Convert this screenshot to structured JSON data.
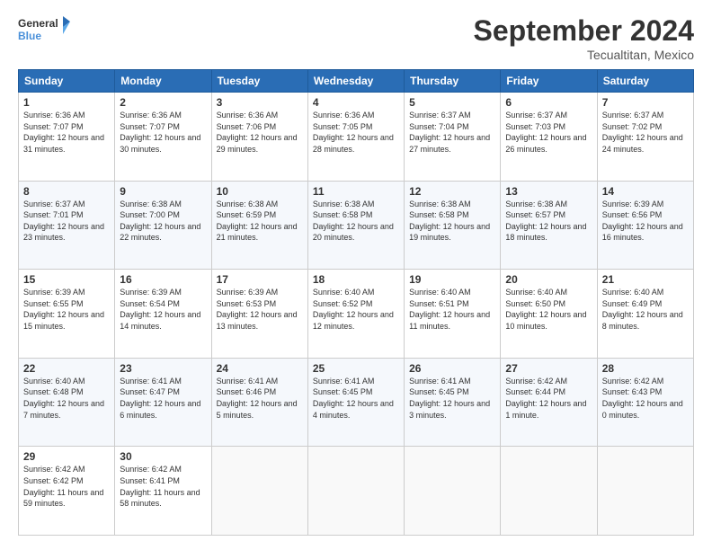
{
  "logo": {
    "line1": "General",
    "line2": "Blue"
  },
  "title": "September 2024",
  "location": "Tecualtitan, Mexico",
  "headers": [
    "Sunday",
    "Monday",
    "Tuesday",
    "Wednesday",
    "Thursday",
    "Friday",
    "Saturday"
  ],
  "weeks": [
    [
      {
        "day": "1",
        "sunrise": "6:36 AM",
        "sunset": "7:07 PM",
        "daylight": "12 hours and 31 minutes."
      },
      {
        "day": "2",
        "sunrise": "6:36 AM",
        "sunset": "7:07 PM",
        "daylight": "12 hours and 30 minutes."
      },
      {
        "day": "3",
        "sunrise": "6:36 AM",
        "sunset": "7:06 PM",
        "daylight": "12 hours and 29 minutes."
      },
      {
        "day": "4",
        "sunrise": "6:36 AM",
        "sunset": "7:05 PM",
        "daylight": "12 hours and 28 minutes."
      },
      {
        "day": "5",
        "sunrise": "6:37 AM",
        "sunset": "7:04 PM",
        "daylight": "12 hours and 27 minutes."
      },
      {
        "day": "6",
        "sunrise": "6:37 AM",
        "sunset": "7:03 PM",
        "daylight": "12 hours and 26 minutes."
      },
      {
        "day": "7",
        "sunrise": "6:37 AM",
        "sunset": "7:02 PM",
        "daylight": "12 hours and 24 minutes."
      }
    ],
    [
      {
        "day": "8",
        "sunrise": "6:37 AM",
        "sunset": "7:01 PM",
        "daylight": "12 hours and 23 minutes."
      },
      {
        "day": "9",
        "sunrise": "6:38 AM",
        "sunset": "7:00 PM",
        "daylight": "12 hours and 22 minutes."
      },
      {
        "day": "10",
        "sunrise": "6:38 AM",
        "sunset": "6:59 PM",
        "daylight": "12 hours and 21 minutes."
      },
      {
        "day": "11",
        "sunrise": "6:38 AM",
        "sunset": "6:58 PM",
        "daylight": "12 hours and 20 minutes."
      },
      {
        "day": "12",
        "sunrise": "6:38 AM",
        "sunset": "6:58 PM",
        "daylight": "12 hours and 19 minutes."
      },
      {
        "day": "13",
        "sunrise": "6:38 AM",
        "sunset": "6:57 PM",
        "daylight": "12 hours and 18 minutes."
      },
      {
        "day": "14",
        "sunrise": "6:39 AM",
        "sunset": "6:56 PM",
        "daylight": "12 hours and 16 minutes."
      }
    ],
    [
      {
        "day": "15",
        "sunrise": "6:39 AM",
        "sunset": "6:55 PM",
        "daylight": "12 hours and 15 minutes."
      },
      {
        "day": "16",
        "sunrise": "6:39 AM",
        "sunset": "6:54 PM",
        "daylight": "12 hours and 14 minutes."
      },
      {
        "day": "17",
        "sunrise": "6:39 AM",
        "sunset": "6:53 PM",
        "daylight": "12 hours and 13 minutes."
      },
      {
        "day": "18",
        "sunrise": "6:40 AM",
        "sunset": "6:52 PM",
        "daylight": "12 hours and 12 minutes."
      },
      {
        "day": "19",
        "sunrise": "6:40 AM",
        "sunset": "6:51 PM",
        "daylight": "12 hours and 11 minutes."
      },
      {
        "day": "20",
        "sunrise": "6:40 AM",
        "sunset": "6:50 PM",
        "daylight": "12 hours and 10 minutes."
      },
      {
        "day": "21",
        "sunrise": "6:40 AM",
        "sunset": "6:49 PM",
        "daylight": "12 hours and 8 minutes."
      }
    ],
    [
      {
        "day": "22",
        "sunrise": "6:40 AM",
        "sunset": "6:48 PM",
        "daylight": "12 hours and 7 minutes."
      },
      {
        "day": "23",
        "sunrise": "6:41 AM",
        "sunset": "6:47 PM",
        "daylight": "12 hours and 6 minutes."
      },
      {
        "day": "24",
        "sunrise": "6:41 AM",
        "sunset": "6:46 PM",
        "daylight": "12 hours and 5 minutes."
      },
      {
        "day": "25",
        "sunrise": "6:41 AM",
        "sunset": "6:45 PM",
        "daylight": "12 hours and 4 minutes."
      },
      {
        "day": "26",
        "sunrise": "6:41 AM",
        "sunset": "6:45 PM",
        "daylight": "12 hours and 3 minutes."
      },
      {
        "day": "27",
        "sunrise": "6:42 AM",
        "sunset": "6:44 PM",
        "daylight": "12 hours and 1 minute."
      },
      {
        "day": "28",
        "sunrise": "6:42 AM",
        "sunset": "6:43 PM",
        "daylight": "12 hours and 0 minutes."
      }
    ],
    [
      {
        "day": "29",
        "sunrise": "6:42 AM",
        "sunset": "6:42 PM",
        "daylight": "11 hours and 59 minutes."
      },
      {
        "day": "30",
        "sunrise": "6:42 AM",
        "sunset": "6:41 PM",
        "daylight": "11 hours and 58 minutes."
      },
      null,
      null,
      null,
      null,
      null
    ]
  ],
  "labels": {
    "sunrise": "Sunrise:",
    "sunset": "Sunset:",
    "daylight": "Daylight:"
  }
}
